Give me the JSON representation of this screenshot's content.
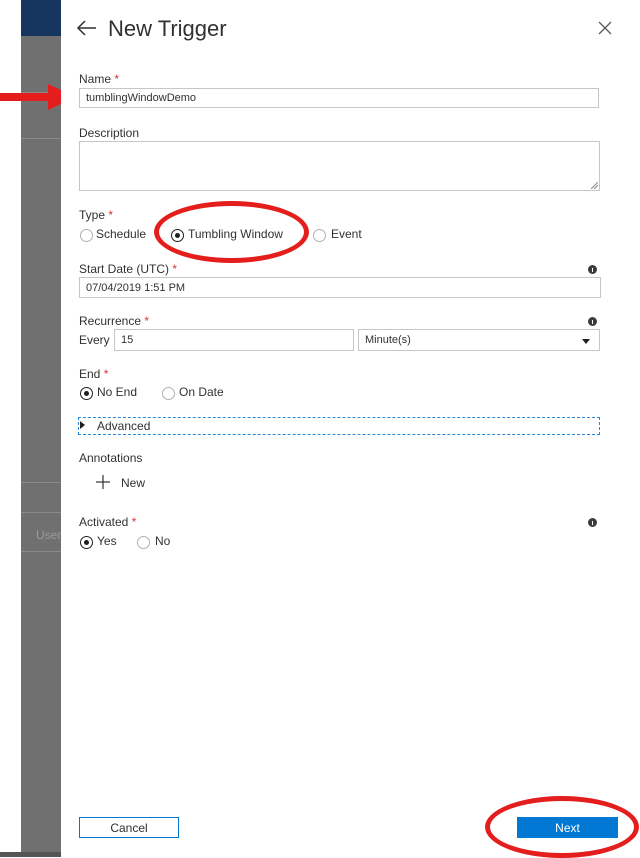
{
  "panel": {
    "title": "New Trigger"
  },
  "background": {
    "side_text": "User"
  },
  "name": {
    "label": "Name",
    "required_mark": "*",
    "value": "tumblingWindowDemo"
  },
  "description": {
    "label": "Description",
    "value": ""
  },
  "type": {
    "label": "Type",
    "required_mark": "*",
    "options": [
      "Schedule",
      "Tumbling Window",
      "Event"
    ],
    "selected": "Tumbling Window"
  },
  "start_date": {
    "label": "Start Date (UTC)",
    "required_mark": "*",
    "value": "07/04/2019 1:51 PM"
  },
  "recurrence": {
    "label": "Recurrence",
    "required_mark": "*",
    "every_label": "Every",
    "interval_value": "15",
    "unit_value": "Minute(s)"
  },
  "end": {
    "label": "End",
    "required_mark": "*",
    "options": [
      "No End",
      "On Date"
    ],
    "selected": "No End"
  },
  "advanced": {
    "label": "Advanced"
  },
  "annotations": {
    "label": "Annotations",
    "new_label": "New"
  },
  "activated": {
    "label": "Activated",
    "required_mark": "*",
    "options": [
      "Yes",
      "No"
    ],
    "selected": "Yes"
  },
  "footer": {
    "cancel_label": "Cancel",
    "next_label": "Next"
  },
  "colors": {
    "accent": "#0078d4",
    "required": "#d13438",
    "annotation": "#e41d1d"
  }
}
